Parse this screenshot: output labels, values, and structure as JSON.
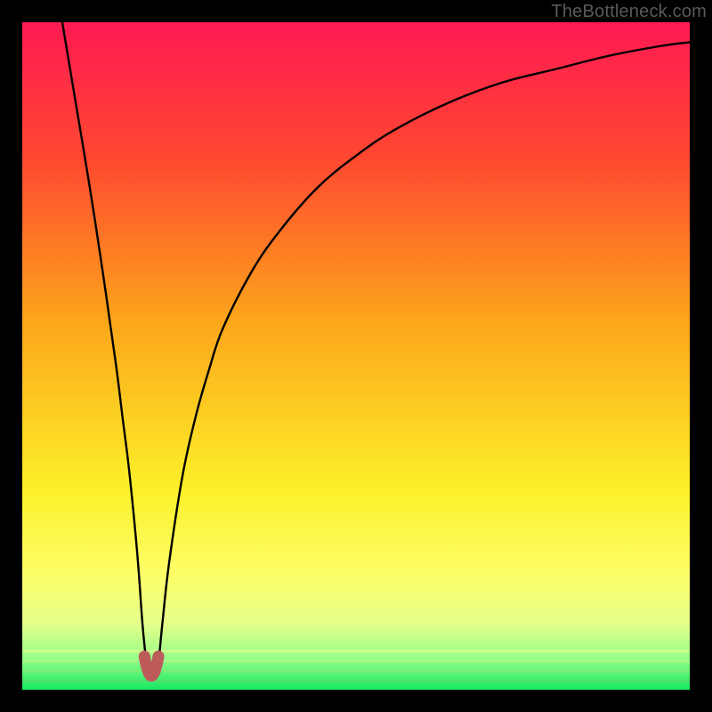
{
  "watermark": "TheBottleneck.com",
  "chart_data": {
    "type": "line",
    "title": "",
    "xlabel": "",
    "ylabel": "",
    "xlim": [
      0,
      100
    ],
    "ylim": [
      0,
      100
    ],
    "grid": false,
    "legend": false,
    "series": [
      {
        "name": "curve",
        "x": [
          6,
          8,
          10,
          12,
          14,
          15,
          16,
          17,
          17.5,
          18,
          18.5,
          19,
          19.5,
          20,
          20.5,
          21,
          22,
          24,
          26,
          28,
          30,
          34,
          38,
          44,
          50,
          56,
          64,
          72,
          80,
          88,
          96,
          100
        ],
        "y": [
          100,
          88,
          76,
          63,
          49,
          41,
          33,
          23,
          17,
          10,
          5,
          2,
          2,
          2,
          5,
          10,
          19,
          32,
          41,
          48,
          54,
          62,
          68,
          75,
          80,
          84,
          88,
          91,
          93,
          95,
          96.5,
          97
        ]
      }
    ],
    "highlight": {
      "name": "optimal-point",
      "x_range": [
        18.3,
        20.4
      ],
      "y_range": [
        0.5,
        5
      ],
      "color": "#bd5b5b"
    },
    "background_gradient": {
      "type": "vertical",
      "stops": [
        {
          "pos": 0.0,
          "color": "#ff1a52"
        },
        {
          "pos": 0.2,
          "color": "#ff4731"
        },
        {
          "pos": 0.45,
          "color": "#fca61a"
        },
        {
          "pos": 0.7,
          "color": "#fcf029"
        },
        {
          "pos": 0.83,
          "color": "#fdff6a"
        },
        {
          "pos": 0.9,
          "color": "#e6ff8a"
        },
        {
          "pos": 0.95,
          "color": "#9cff8a"
        },
        {
          "pos": 1.0,
          "color": "#17e863"
        }
      ]
    },
    "bottom_stripes": [
      {
        "y": 0.985,
        "color": "#5bd96a"
      },
      {
        "y": 0.97,
        "color": "#8fe87a"
      },
      {
        "y": 0.955,
        "color": "#c2f58a"
      },
      {
        "y": 0.94,
        "color": "#eaff8a"
      }
    ]
  }
}
